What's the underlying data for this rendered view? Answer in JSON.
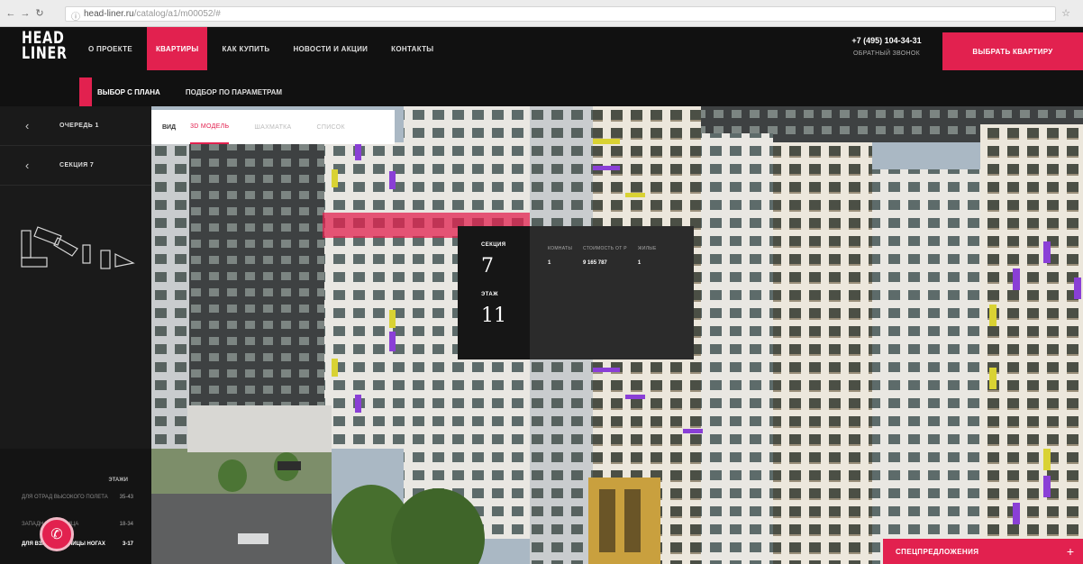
{
  "browser": {
    "url_domain": "head-liner.ru",
    "url_path": "/catalog/a1/m00052/#",
    "back_icon": "arrow-left-icon",
    "forward_icon": "arrow-right-icon",
    "reload_icon": "reload-icon",
    "bookmark_icon": "star-icon"
  },
  "brand": {
    "logo_line1": "HEAD",
    "logo_line2": "LINER",
    "accent_color": "#e2214f"
  },
  "nav": {
    "items": [
      {
        "label": "О ПРОЕКТЕ",
        "active": false
      },
      {
        "label": "КВАРТИРЫ",
        "active": true
      },
      {
        "label": "КАК КУПИТЬ",
        "active": false
      },
      {
        "label": "НОВОСТИ И АКЦИИ",
        "active": false
      },
      {
        "label": "КОНТАКТЫ",
        "active": false
      }
    ],
    "subitems": [
      {
        "label": "ВЫБОР С ПЛАНА",
        "active": true
      },
      {
        "label": "ПОДБОР ПО ПАРАМЕТРАМ",
        "active": false
      }
    ]
  },
  "header": {
    "phone": "+7 (495) 104-34-31",
    "callback": "ОБРАТНЫЙ ЗВОНОК",
    "cta": "ВЫБРАТЬ КВАРТИРУ"
  },
  "sidebar": {
    "queue_label": "ОЧЕРЕДЬ 1",
    "section_label": "СЕКЦИЯ 7",
    "legend_header": "ЭТАЖИ",
    "legend_rows": [
      {
        "label": "ДЛЯ ОТРАД ВЫСОКОГО ПОЛЕТА",
        "value": "35-43"
      },
      {
        "label": "ЗАПАДНАЯ СТОЛИЦА",
        "value": "18-34"
      },
      {
        "label": "ДЛЯ ВЗЛЕТА СТОЛИЦЫ НОГАХ",
        "value": "3-17"
      }
    ]
  },
  "viewtabs": {
    "label": "ВИД",
    "tabs": [
      {
        "label": "3D МОДЕЛЬ",
        "active": true
      },
      {
        "label": "ШАХМАТКА",
        "active": false
      },
      {
        "label": "СПИСОК",
        "active": false
      }
    ]
  },
  "info": {
    "section_key": "СЕКЦИЯ",
    "section_value": "7",
    "floor_key": "ЭТАЖ",
    "floor_value": "11",
    "cols": [
      {
        "header": "КОМНАТЫ",
        "value": "1"
      },
      {
        "header": "СТОИМОСТЬ ОТ Р",
        "value": "9 165 787"
      },
      {
        "header": "ЖИЛЫЕ",
        "value": "1"
      }
    ]
  },
  "special": {
    "label": "СПЕЦПРЕДЛОЖЕНИЯ"
  }
}
